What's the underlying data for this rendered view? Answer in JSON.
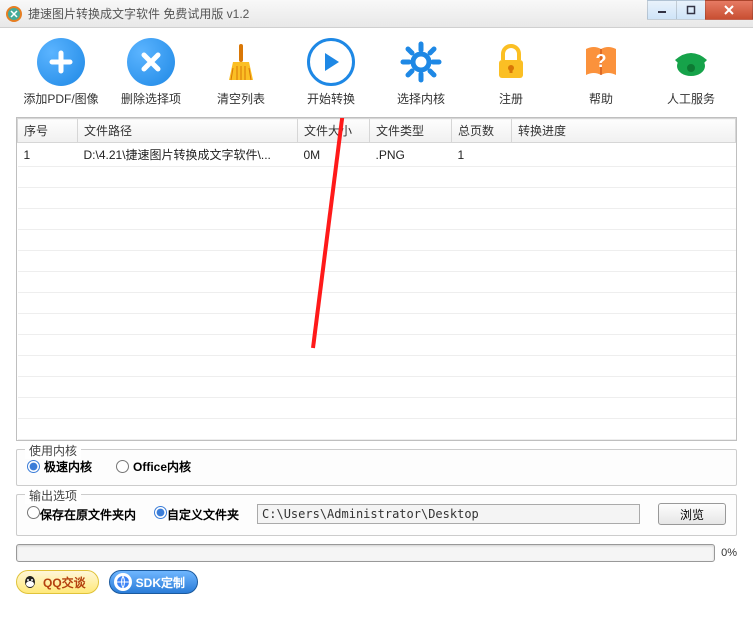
{
  "window": {
    "title": "捷速图片转换成文字软件 免费试用版 v1.2"
  },
  "toolbar": [
    {
      "label": "添加PDF/图像"
    },
    {
      "label": "删除选择项"
    },
    {
      "label": "清空列表"
    },
    {
      "label": "开始转换"
    },
    {
      "label": "选择内核"
    },
    {
      "label": "注册"
    },
    {
      "label": "帮助"
    },
    {
      "label": "人工服务"
    }
  ],
  "table": {
    "headers": [
      "序号",
      "文件路径",
      "文件大小",
      "文件类型",
      "总页数",
      "转换进度"
    ],
    "rows": [
      {
        "seq": "1",
        "path": "D:\\4.21\\捷速图片转换成文字软件\\...",
        "size": "0M",
        "type": ".PNG",
        "pages": "1",
        "progress": ""
      }
    ]
  },
  "kernel": {
    "title": "使用内核",
    "fast": "极速内核",
    "office": "Office内核"
  },
  "output": {
    "title": "输出选项",
    "save_original": "保存在原文件夹内",
    "custom_folder": "自定义文件夹",
    "path": "C:\\Users\\Administrator\\Desktop",
    "browse": "浏览"
  },
  "progress": {
    "percent": "0%"
  },
  "bottom": {
    "qq": "QQ交谈",
    "sdk": "SDK定制"
  }
}
